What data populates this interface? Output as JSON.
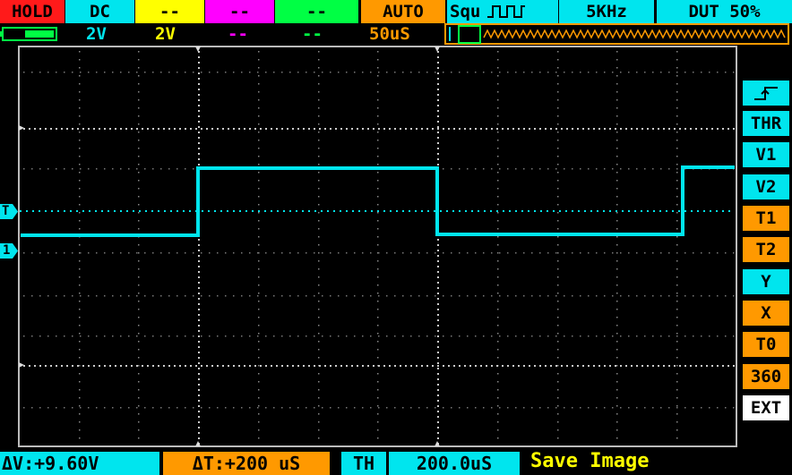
{
  "top_bar": {
    "hold": "HOLD",
    "coupling": "DC",
    "ch2_coupling": "--",
    "ch3_coupling": "--",
    "ch4_coupling": "--",
    "trigger_mode": "AUTO",
    "wave_type": "Squ",
    "frequency": "5KHz",
    "duty": "DUT 50%"
  },
  "second_bar": {
    "ch1_scale": "2V",
    "ch2_scale": "2V",
    "ch3_scale": "--",
    "ch4_scale": "--",
    "timebase": "50uS"
  },
  "markers": {
    "trigger": "T",
    "channel1": "1"
  },
  "side_menu": {
    "items": [
      "THR",
      "V1",
      "V2",
      "T1",
      "T2",
      "Y",
      "X",
      "T0",
      "360",
      "EXT"
    ]
  },
  "bottom_bar": {
    "delta_v": "ΔV:+9.60V",
    "delta_t": "ΔT:+200 uS",
    "th_label": "TH",
    "th_value": "200.0uS",
    "status": "Save Image"
  },
  "colors": {
    "cyan": "#00e5ee",
    "orange": "#ff9900",
    "red": "#ff1a1a",
    "yellow": "#ffff00",
    "magenta": "#ff00ff",
    "green": "#00ff44",
    "battery": "#00ff44"
  },
  "icons": [
    "battery-icon",
    "square-wave-icon",
    "trigger-edge-icon",
    "rising-edge-icon"
  ]
}
